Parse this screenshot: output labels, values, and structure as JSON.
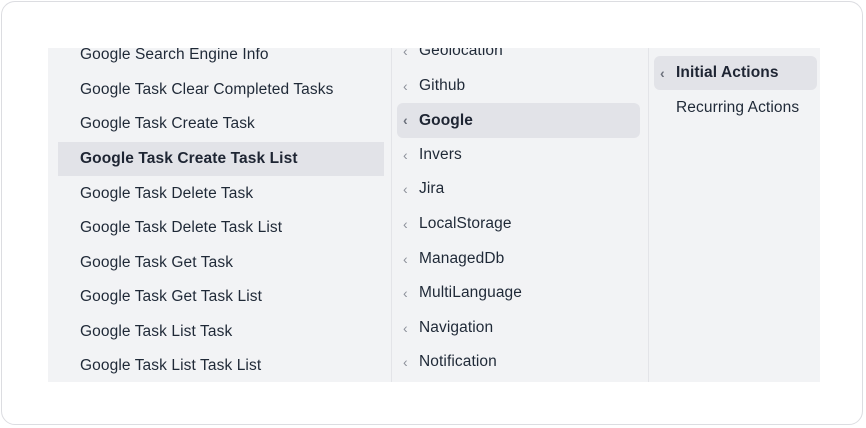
{
  "col1": {
    "items": [
      {
        "label": "Google Search Engine Info"
      },
      {
        "label": "Google Task Clear Completed Tasks"
      },
      {
        "label": "Google Task Create Task"
      },
      {
        "label": "Google Task Create Task List"
      },
      {
        "label": "Google Task Delete Task"
      },
      {
        "label": "Google Task Delete Task List"
      },
      {
        "label": "Google Task Get Task"
      },
      {
        "label": "Google Task Get Task List"
      },
      {
        "label": "Google Task List Task"
      },
      {
        "label": "Google Task List Task List"
      }
    ],
    "selected": "Google Task Create Task List"
  },
  "col2": {
    "items": [
      {
        "label": "Geolocation"
      },
      {
        "label": "Github"
      },
      {
        "label": "Google"
      },
      {
        "label": "Invers"
      },
      {
        "label": "Jira"
      },
      {
        "label": "LocalStorage"
      },
      {
        "label": "ManagedDb"
      },
      {
        "label": "MultiLanguage"
      },
      {
        "label": "Navigation"
      },
      {
        "label": "Notification"
      }
    ],
    "selected": "Google",
    "chevron": "‹"
  },
  "col3": {
    "items": [
      {
        "label": "Initial Actions"
      },
      {
        "label": "Recurring Actions"
      }
    ],
    "selected": "Initial Actions",
    "chevron": "‹"
  }
}
